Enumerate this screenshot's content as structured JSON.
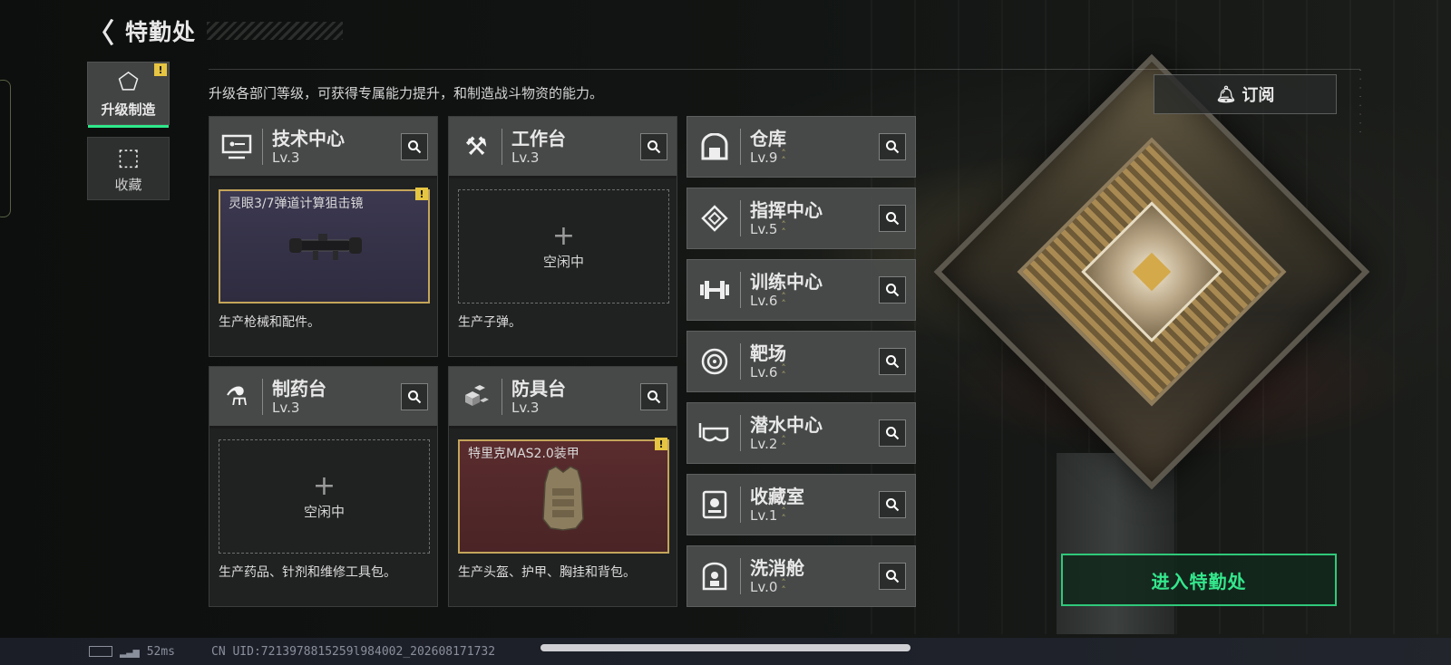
{
  "header": {
    "title": "特勤处",
    "back_icon": "back-arrow-icon"
  },
  "side_tabs": [
    {
      "label": "升级制造",
      "icon": "upgrade-icon",
      "active": true,
      "warning": "!"
    },
    {
      "label": "收藏",
      "icon": "collection-icon",
      "active": false
    }
  ],
  "description": "升级各部门等级，可获得专属能力提升，和制造战斗物资的能力。",
  "subscribe": {
    "label": "订阅",
    "icon": "bell-icon"
  },
  "main_departments": [
    {
      "name": "技术中心",
      "level": "Lv.3",
      "icon": "monitor-icon",
      "slot": {
        "state": "item",
        "item_name": "灵眼3/7弹道计算狙击镜",
        "warning": "!",
        "color": "#3b3850"
      },
      "footer": "生产枪械和配件。"
    },
    {
      "name": "工作台",
      "level": "Lv.3",
      "icon": "tools-icon",
      "slot": {
        "state": "idle",
        "idle_text": "空闲中"
      },
      "footer": "生产子弹。"
    },
    {
      "name": "制药台",
      "level": "Lv.3",
      "icon": "microscope-icon",
      "slot": {
        "state": "idle",
        "idle_text": "空闲中"
      },
      "footer": "生产药品、针剂和维修工具包。"
    },
    {
      "name": "防具台",
      "level": "Lv.3",
      "icon": "armor-blocks-icon",
      "slot": {
        "state": "item",
        "item_name": "特里克MAS2.0装甲",
        "warning": "!",
        "color": "#5a2c2e"
      },
      "footer": "生产头盔、护甲、胸挂和背包。"
    }
  ],
  "side_departments": [
    {
      "name": "仓库",
      "level": "Lv.9",
      "icon": "warehouse-icon"
    },
    {
      "name": "指挥中心",
      "level": "Lv.5",
      "icon": "command-icon"
    },
    {
      "name": "训练中心",
      "level": "Lv.6",
      "icon": "dumbbell-icon"
    },
    {
      "name": "靶场",
      "level": "Lv.6",
      "icon": "target-icon"
    },
    {
      "name": "潜水中心",
      "level": "Lv.2",
      "icon": "diving-mask-icon"
    },
    {
      "name": "收藏室",
      "level": "Lv.1",
      "icon": "collection-room-icon"
    },
    {
      "name": "洗消舱",
      "level": "Lv.0",
      "icon": "decon-chamber-icon"
    }
  ],
  "enter_button": "进入特勤处",
  "status_bar": {
    "ping": "52ms",
    "uid": "CN UID:7213978815259l984002_202608171732"
  },
  "colors": {
    "accent_green": "#2fc97a",
    "warning_yellow": "#e6c542",
    "item_border": "#c4a55a"
  }
}
